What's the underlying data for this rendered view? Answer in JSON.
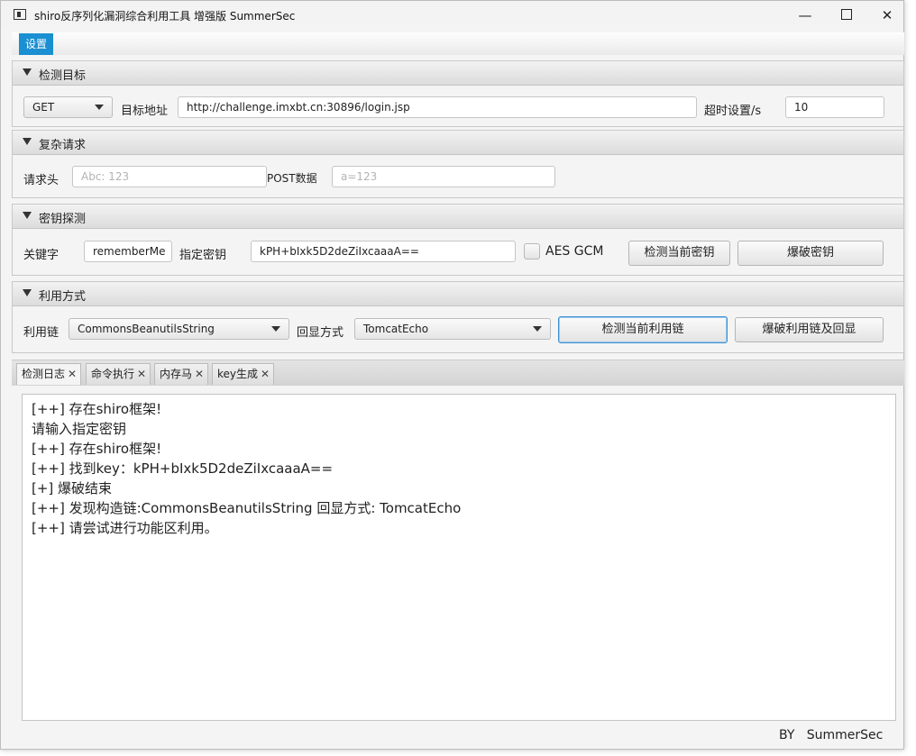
{
  "window": {
    "title": "shiro反序列化漏洞综合利用工具 增强版 SummerSec",
    "controls": {
      "minimize": "—",
      "close": "✕"
    }
  },
  "menu": {
    "settings": "设置"
  },
  "target": {
    "section_title": "检测目标",
    "method": "GET",
    "url_label": "目标地址",
    "url_value": "http://challenge.imxbt.cn:30896/login.jsp",
    "timeout_label": "超时设置/s",
    "timeout_value": "10"
  },
  "complex": {
    "section_title": "复杂请求",
    "headers_label": "请求头",
    "headers_placeholder": "Abc: 123",
    "post_label": "POST数据",
    "post_placeholder": "a=123"
  },
  "key": {
    "section_title": "密钥探测",
    "keyword_label": "关键字",
    "keyword_value": "rememberMe",
    "key_label": "指定密钥",
    "key_value": "kPH+bIxk5D2deZiIxcaaaA==",
    "aes_gcm_label": "AES GCM",
    "aes_gcm_checked": false,
    "check_key_button": "检测当前密钥",
    "brute_key_button": "爆破密钥"
  },
  "exploit": {
    "section_title": "利用方式",
    "chain_label": "利用链",
    "chain_value": "CommonsBeanutilsString",
    "echo_label": "回显方式",
    "echo_value": "TomcatEcho",
    "check_chain_button": "检测当前利用链",
    "brute_chain_button": "爆破利用链及回显"
  },
  "tabs": [
    {
      "label": "检测日志",
      "active": true
    },
    {
      "label": "命令执行",
      "active": false
    },
    {
      "label": "内存马",
      "active": false
    },
    {
      "label": "key生成",
      "active": false
    }
  ],
  "tab_close": "✕",
  "log": [
    "[++] 存在shiro框架!",
    "请输入指定密钥",
    "[++] 存在shiro框架!",
    "[++] 找到key：kPH+bIxk5D2deZiIxcaaaA==",
    "[+] 爆破结束",
    "[++] 发现构造链:CommonsBeanutilsString  回显方式: TomcatEcho",
    "[++] 请尝试进行功能区利用。"
  ],
  "footer": "BY   SummerSec"
}
